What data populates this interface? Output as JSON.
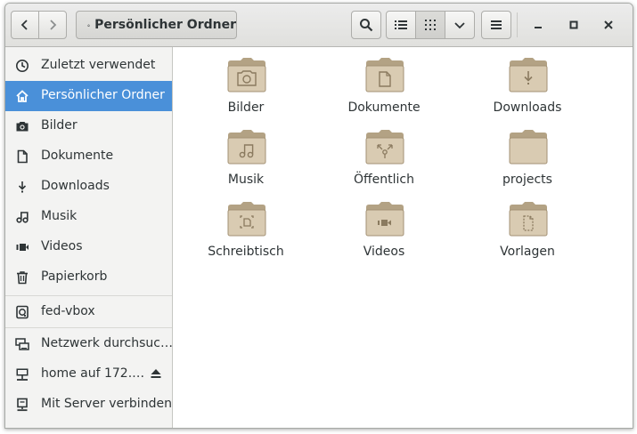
{
  "headerbar": {
    "path_label": "Persönlicher Ordner"
  },
  "sidebar": {
    "places": [
      {
        "label": "Zuletzt verwendet",
        "icon": "clock-icon"
      },
      {
        "label": "Persönlicher Ordner",
        "icon": "home-icon",
        "active": true
      },
      {
        "label": "Bilder",
        "icon": "camera-icon"
      },
      {
        "label": "Dokumente",
        "icon": "document-icon"
      },
      {
        "label": "Downloads",
        "icon": "download-icon"
      },
      {
        "label": "Musik",
        "icon": "music-icon"
      },
      {
        "label": "Videos",
        "icon": "video-icon"
      },
      {
        "label": "Papierkorb",
        "icon": "trash-icon"
      }
    ],
    "devices": [
      {
        "label": "fed-vbox",
        "icon": "drive-icon"
      }
    ],
    "network": [
      {
        "label": "Netzwerk durchsuc…",
        "icon": "network-icon"
      },
      {
        "label": "home auf 172.…",
        "icon": "network-share-icon"
      },
      {
        "label": "Mit Server verbinden",
        "icon": "server-icon"
      }
    ]
  },
  "folders": [
    {
      "label": "Bilder",
      "emblem": "camera"
    },
    {
      "label": "Dokumente",
      "emblem": "document"
    },
    {
      "label": "Downloads",
      "emblem": "download"
    },
    {
      "label": "Musik",
      "emblem": "music"
    },
    {
      "label": "Öffentlich",
      "emblem": "share"
    },
    {
      "label": "projects",
      "emblem": "none"
    },
    {
      "label": "Schreibtisch",
      "emblem": "desktop"
    },
    {
      "label": "Videos",
      "emblem": "video"
    },
    {
      "label": "Vorlagen",
      "emblem": "template"
    }
  ],
  "colors": {
    "accent": "#4a90d9",
    "folder": "#d9cbb2",
    "folder_dark": "#a39275"
  }
}
